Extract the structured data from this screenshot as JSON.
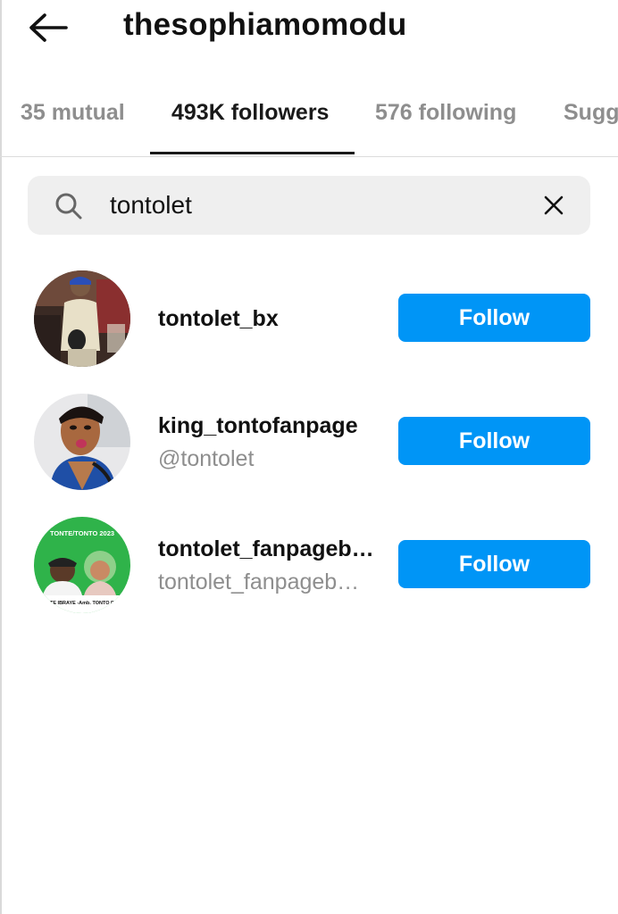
{
  "header": {
    "title": "thesophiamomodu"
  },
  "tabs": [
    {
      "label": "35 mutual",
      "active": false
    },
    {
      "label": "493K followers",
      "active": true
    },
    {
      "label": "576 following",
      "active": false
    },
    {
      "label": "Sugg",
      "active": false
    }
  ],
  "search": {
    "value": "tontolet"
  },
  "results": [
    {
      "username": "tontolet_bx",
      "subname": "",
      "button": "Follow",
      "avatar": "person-photo-avatar"
    },
    {
      "username": "king_tontofanpage",
      "subname": "@tontolet",
      "button": "Follow",
      "avatar": "woman-photo-avatar"
    },
    {
      "username": "tontolet_fanpageb…",
      "subname": "tontolet_fanpageb…",
      "button": "Follow",
      "avatar": "campaign-poster-avatar",
      "avatar_text": [
        "TONTE/TONTO 2023",
        "TE IBRAYE -Amb. TONTO D"
      ]
    }
  ],
  "colors": {
    "follow_button": "#0095f6",
    "search_bg": "#efefef",
    "muted_text": "#8e8e8e"
  }
}
